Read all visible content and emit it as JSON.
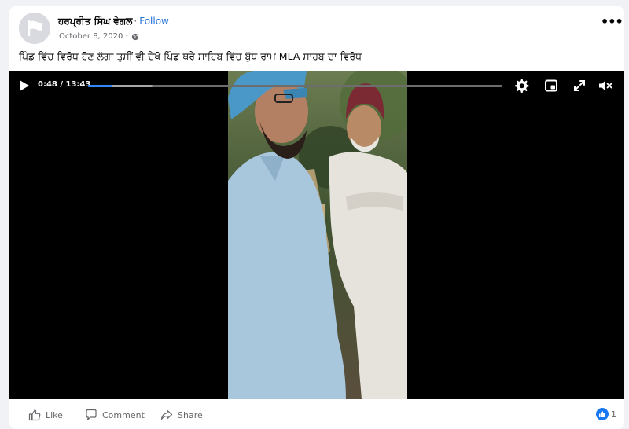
{
  "post": {
    "author": "ਹਰਪ੍ਰੀਤ ਸਿੰਘ ਵੇਗਲ",
    "separator": "·",
    "follow_label": "Follow",
    "date": "October 8, 2020 ·",
    "privacy_icon": "globe-icon",
    "more_label": "•••",
    "caption": "ਪਿੰਡ ਵਿੱਚ ਵਿਰੋਧ ਹੋਣ ਲੱਗਾ ਤੁਸੀਂ ਵੀ ਦੇਖੋ ਪਿੰਡ ਥਰੇ ਸਾਹਿਬ ਵਿੱਚ ਬੁੱਧ ਰਾਮ MLA ਸਾਹਬ ਦਾ ਵਿਰੋਧ"
  },
  "video": {
    "time": "0:48 / 13:43",
    "played_fraction": 0.058,
    "buffered_fraction": 0.155,
    "icons": [
      "play-icon",
      "settings-gear-icon",
      "picture-in-picture-icon",
      "fullscreen-icon",
      "mute-icon"
    ]
  },
  "actions": {
    "like_label": "Like",
    "comment_label": "Comment",
    "share_label": "Share",
    "reaction_count": "1"
  },
  "colors": {
    "accent": "#216fdb",
    "progress_played": "#2d88ff",
    "reaction_like": "#1877f2",
    "secondary_text": "#65676b"
  }
}
